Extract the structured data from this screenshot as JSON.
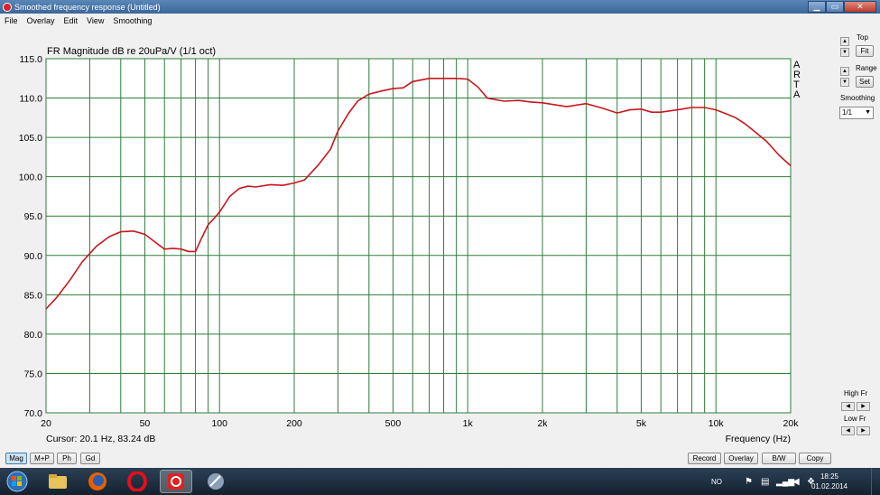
{
  "window": {
    "title": "Smoothed frequency response (Untitled)",
    "minimize": "▁",
    "maximize": "▭",
    "close": "✕"
  },
  "menu": [
    "File",
    "Overlay",
    "Edit",
    "View",
    "Smoothing"
  ],
  "plot": {
    "title": "FR Magnitude dB re 20uPa/V (1/1 oct)",
    "brand": [
      "A",
      "R",
      "T",
      "A"
    ],
    "cursor": "Cursor: 20.1 Hz, 83.24 dB",
    "xlabel": "Frequency (Hz)"
  },
  "chart_data": {
    "type": "line",
    "title": "FR Magnitude dB re 20uPa/V (1/1 oct)",
    "xlabel": "Frequency (Hz)",
    "ylabel": "",
    "xscale": "log",
    "xlim": [
      20,
      20000
    ],
    "ylim": [
      70,
      115
    ],
    "grid": true,
    "line_color": "#c8161e",
    "grid_color": "#2e7d3a",
    "y_ticks": [
      "115.0",
      "110.0",
      "105.0",
      "100.0",
      "95.0",
      "90.0",
      "85.0",
      "80.0",
      "75.0",
      "70.0"
    ],
    "x_tick_labels": [
      {
        "v": 20,
        "t": "20"
      },
      {
        "v": 50,
        "t": "50"
      },
      {
        "v": 100,
        "t": "100"
      },
      {
        "v": 200,
        "t": "200"
      },
      {
        "v": 500,
        "t": "500"
      },
      {
        "v": 1000,
        "t": "1k"
      },
      {
        "v": 2000,
        "t": "2k"
      },
      {
        "v": 5000,
        "t": "5k"
      },
      {
        "v": 10000,
        "t": "10k"
      },
      {
        "v": 20000,
        "t": "20k"
      }
    ],
    "series": [
      {
        "x": [
          20,
          22,
          25,
          28,
          32,
          36,
          40,
          45,
          50,
          55,
          60,
          65,
          70,
          75,
          80,
          85,
          90,
          95,
          100,
          110,
          120,
          130,
          140,
          160,
          180,
          200,
          220,
          250,
          280,
          300,
          330,
          360,
          400,
          450,
          500,
          550,
          600,
          700,
          800,
          900,
          1000,
          1100,
          1200,
          1400,
          1600,
          1800,
          2000,
          2500,
          3000,
          3500,
          4000,
          4500,
          5000,
          5500,
          6000,
          7000,
          8000,
          9000,
          10000,
          11000,
          12000,
          13000,
          14000,
          16000,
          18000,
          20000
        ],
        "y": [
          83.2,
          84.6,
          86.9,
          89.2,
          91.2,
          92.4,
          93.0,
          93.1,
          92.7,
          91.7,
          90.8,
          90.9,
          90.8,
          90.5,
          90.5,
          92.3,
          93.9,
          94.7,
          95.5,
          97.5,
          98.5,
          98.8,
          98.7,
          99.0,
          98.9,
          99.2,
          99.6,
          101.5,
          103.5,
          105.8,
          108.0,
          109.6,
          110.5,
          110.9,
          111.2,
          111.3,
          112.1,
          112.5,
          112.5,
          112.5,
          112.4,
          111.4,
          110.0,
          109.6,
          109.7,
          109.5,
          109.4,
          108.9,
          109.3,
          108.7,
          108.1,
          108.5,
          108.6,
          108.2,
          108.2,
          108.5,
          108.8,
          108.8,
          108.5,
          108.0,
          107.5,
          106.8,
          106.0,
          104.5,
          102.7,
          101.4
        ]
      }
    ]
  },
  "side": {
    "top_label": "Top",
    "fit_label": "Fit",
    "range_label": "Range",
    "set_label": "Set",
    "smoothing_label": "Smoothing",
    "smoothing_value": "1/1",
    "highfr_label": "High Fr",
    "lowfr_label": "Low Fr"
  },
  "bottom_left": [
    "Mag",
    "M+P",
    "Ph",
    "Gd"
  ],
  "bottom_right": [
    "Record",
    "Overlay",
    "B/W",
    "Copy"
  ],
  "taskbar": {
    "lang": "NO",
    "time": "18:25",
    "date": "01.02.2014"
  }
}
